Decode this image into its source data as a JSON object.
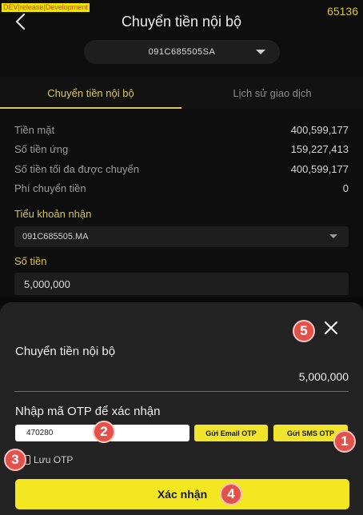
{
  "dev_banner": "DEV|release|Development",
  "build_number": "65136",
  "header": {
    "title": "Chuyển tiền nội bộ",
    "account": "091C685505SA"
  },
  "tabs": [
    {
      "label": "Chuyển tiền nội bộ",
      "active": true
    },
    {
      "label": "Lịch sử giao dịch",
      "active": false
    }
  ],
  "info_rows": [
    {
      "label": "Tiền mặt",
      "value": "400,599,177"
    },
    {
      "label": "Số tiền ứng",
      "value": "159,227,413"
    },
    {
      "label": "Số tiền tối đa được chuyển",
      "value": "400,599,177"
    },
    {
      "label": "Phí chuyển tiền",
      "value": "0"
    }
  ],
  "receive_account": {
    "label": "Tiểu khoản nhận",
    "value": "091C685505.MA"
  },
  "amount": {
    "label": "Số tiền",
    "value": "5,000,000"
  },
  "sheet": {
    "title": "Chuyển tiền nội bộ",
    "amount": "5,000,000",
    "otp_label": "Nhập mã OTP để xác nhận",
    "otp_value": "470280",
    "email_otp_button": "Gửi Email OTP",
    "sms_otp_button": "Gửi SMS OTP",
    "save_otp_label": "Lưu OTP",
    "confirm_button": "Xác nhận"
  },
  "callouts": [
    "1",
    "2",
    "3",
    "4",
    "5"
  ],
  "colors": {
    "accent": "#d8c76a",
    "button_yellow": "#f3e722",
    "callout_red": "#e2524a",
    "background": "#0e0e0e",
    "sheet": "#232323"
  },
  "icons": {
    "back": "chevron-left-icon",
    "close": "close-icon",
    "dropdown": "caret-down-icon"
  }
}
